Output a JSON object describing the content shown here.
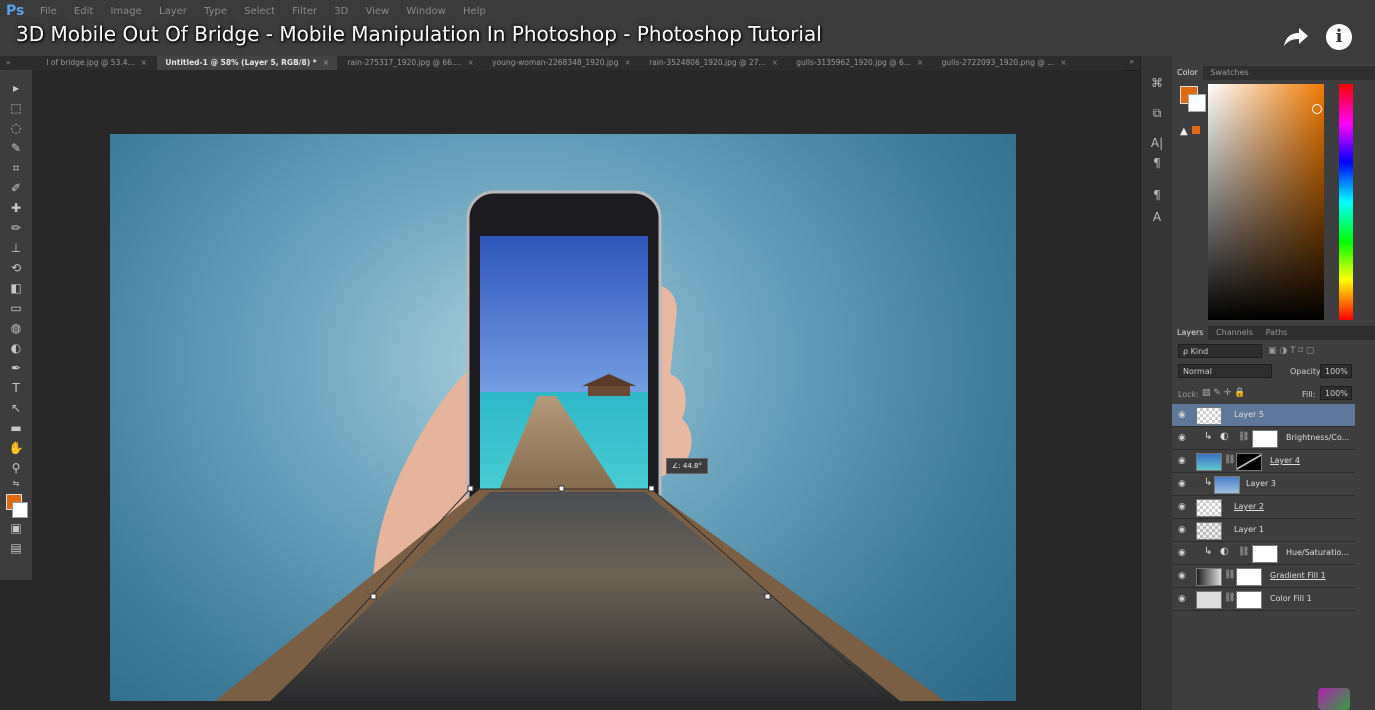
{
  "app": {
    "logo": "Ps",
    "menu": [
      "File",
      "Edit",
      "Image",
      "Layer",
      "Type",
      "Select",
      "Filter",
      "3D",
      "View",
      "Window",
      "Help"
    ]
  },
  "video": {
    "title": "3D Mobile Out Of Bridge - Mobile Manipulation In Photoshop - Photoshop Tutorial"
  },
  "document_tabs": [
    {
      "label": "l of bridge.jpg @ 53.4...",
      "active": false
    },
    {
      "label": "Untitled-1 @ 58% (Layer 5, RGB/8) *",
      "active": true
    },
    {
      "label": "rain-275317_1920.jpg @ 66....",
      "active": false
    },
    {
      "label": "young-woman-2268348_1920.jpg",
      "active": false
    },
    {
      "label": "rain-3524806_1920.jpg @ 27...",
      "active": false
    },
    {
      "label": "gulls-3135962_1920.jpg @ 6...",
      "active": false
    },
    {
      "label": "gulls-2722093_1920.png @ ...",
      "active": false
    }
  ],
  "transform": {
    "angle_readout": "∠: 44.8°"
  },
  "color_panel": {
    "tabs": [
      "Color",
      "Swatches"
    ],
    "foreground": "#e06a10",
    "background": "#ffffff"
  },
  "layers_panel": {
    "tabs": [
      "Layers",
      "Channels",
      "Paths"
    ],
    "filter_kind": "ρ Kind",
    "blend_mode": "Normal",
    "opacity_label": "Opacity:",
    "opacity_value": "100%",
    "lock_label": "Lock:",
    "fill_label": "Fill:",
    "fill_value": "100%",
    "layers": [
      {
        "name": "Layer 5",
        "selected": true,
        "type": "pixel"
      },
      {
        "name": "Brightness/Co...",
        "selected": false,
        "type": "adjustment"
      },
      {
        "name": "Layer 4",
        "selected": false,
        "type": "masked"
      },
      {
        "name": "Layer 3",
        "selected": false,
        "type": "clipped"
      },
      {
        "name": "Layer 2",
        "selected": false,
        "type": "pixel"
      },
      {
        "name": "Layer 1",
        "selected": false,
        "type": "pixel"
      },
      {
        "name": "Hue/Saturatio...",
        "selected": false,
        "type": "adjustment"
      },
      {
        "name": "Gradient Fill 1",
        "selected": false,
        "type": "fill"
      },
      {
        "name": "Color Fill 1",
        "selected": false,
        "type": "fill"
      }
    ]
  }
}
